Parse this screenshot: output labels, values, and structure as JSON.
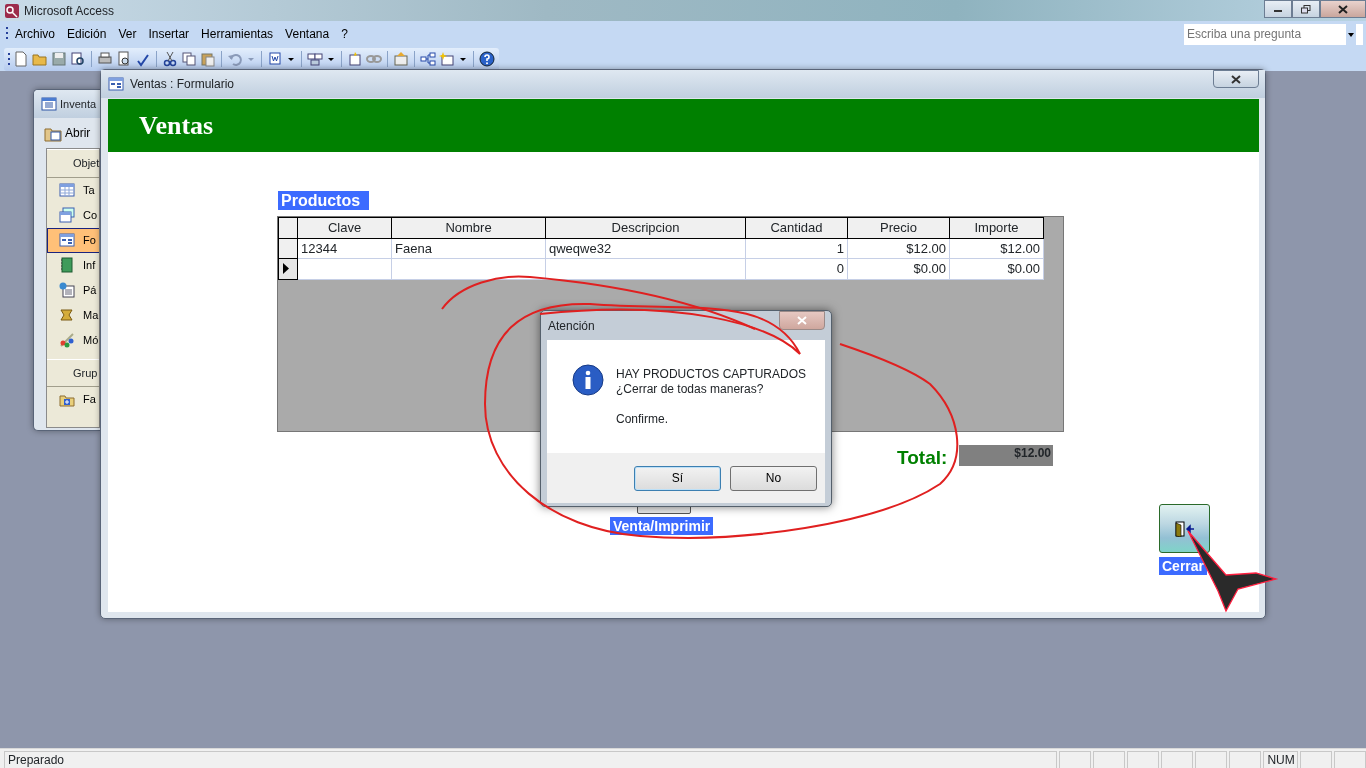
{
  "app_window": {
    "title": "Microsoft Access"
  },
  "menu": [
    {
      "label": "Archivo"
    },
    {
      "label": "Edición"
    },
    {
      "label": "Ver"
    },
    {
      "label": "Insertar"
    },
    {
      "label": "Herramientas"
    },
    {
      "label": "Ventana"
    },
    {
      "label": "?"
    }
  ],
  "help_box": {
    "placeholder": "Escriba una pregunta"
  },
  "inventory_window": {
    "title": "Inventa",
    "open_button": "Abrir",
    "groups": [
      {
        "header": "Objet",
        "items": [
          {
            "label": "Ta",
            "selected": false
          },
          {
            "label": "Co",
            "selected": false
          },
          {
            "label": "Fo",
            "selected": true
          },
          {
            "label": "Inf",
            "selected": false
          },
          {
            "label": "Pá",
            "selected": false
          },
          {
            "label": "Ma",
            "selected": false
          },
          {
            "label": "Mó",
            "selected": false
          }
        ]
      },
      {
        "header": "Grup",
        "items": [
          {
            "label": "Fa",
            "selected": false
          }
        ]
      }
    ]
  },
  "form_window": {
    "title": "Ventas : Formulario",
    "header": "Ventas",
    "subform_label": "Productos",
    "table": {
      "columns": [
        {
          "label": "Clave",
          "numeric": false
        },
        {
          "label": "Nombre",
          "numeric": false
        },
        {
          "label": "Descripcion",
          "numeric": false
        },
        {
          "label": "Cantidad",
          "numeric": true
        },
        {
          "label": "Precio",
          "numeric": true
        },
        {
          "label": "Importe",
          "numeric": true
        }
      ],
      "rows": [
        {
          "selected": false,
          "cells": [
            "12344",
            "Faena",
            "qweqwe32",
            "1",
            "$12.00",
            "$12.00"
          ]
        },
        {
          "selected": true,
          "cells": [
            "",
            "",
            "",
            "0",
            "$0.00",
            "$0.00"
          ]
        }
      ]
    },
    "total_label": "Total:",
    "total_value": "$12.00",
    "print_label": "Venta/Imprimir",
    "close_label": "Cerrar"
  },
  "dialog": {
    "title": "Atención",
    "lines": [
      "HAY PRODUCTOS CAPTURADOS",
      "¿Cerrar de todas maneras?"
    ],
    "note": "Confirme.",
    "buttons": [
      "Sí",
      "No"
    ]
  },
  "status_bar": {
    "text": "Preparado",
    "indicators": [
      {
        "label": "NUM"
      }
    ]
  }
}
